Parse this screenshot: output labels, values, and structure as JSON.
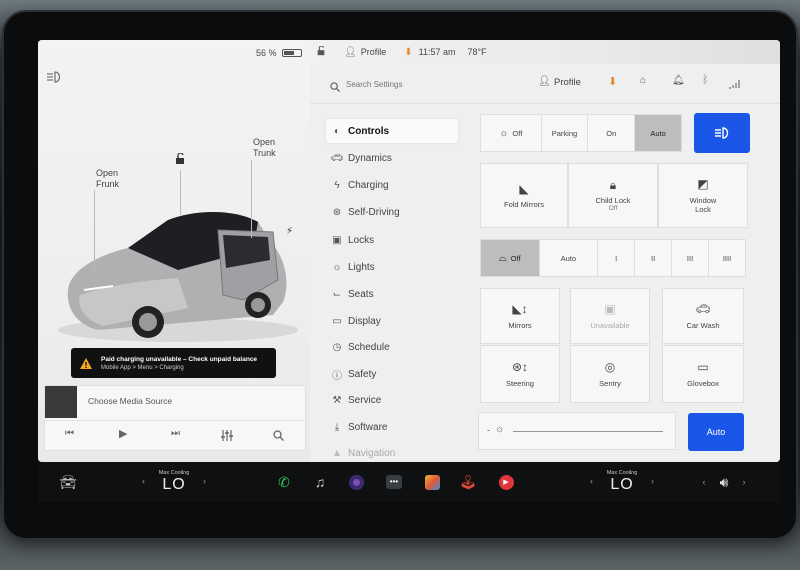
{
  "status": {
    "battery": "56 %",
    "profile": "Profile",
    "time": "11:57 am",
    "temperature": "78°F"
  },
  "left": {
    "open_frunk": "Open\nFrunk",
    "open_trunk": "Open\nTrunk",
    "alert_title": "Paid charging unavailable – Check unpaid balance",
    "alert_sub": "Mobile App > Menu > Charging",
    "media_source": "Choose Media Source"
  },
  "search": {
    "placeholder": "Search Settings"
  },
  "topbar": {
    "profile": "Profile"
  },
  "menu": [
    {
      "label": "Controls",
      "icon": "toggle-icon"
    },
    {
      "label": "Dynamics",
      "icon": "car-icon"
    },
    {
      "label": "Charging",
      "icon": "bolt-icon"
    },
    {
      "label": "Self-Driving",
      "icon": "steering-wheel-icon"
    },
    {
      "label": "Locks",
      "icon": "lock-icon"
    },
    {
      "label": "Lights",
      "icon": "sun-icon"
    },
    {
      "label": "Seats",
      "icon": "seat-icon"
    },
    {
      "label": "Display",
      "icon": "display-icon"
    },
    {
      "label": "Schedule",
      "icon": "clock-icon"
    },
    {
      "label": "Safety",
      "icon": "info-icon"
    },
    {
      "label": "Service",
      "icon": "wrench-icon"
    },
    {
      "label": "Software",
      "icon": "download-icon"
    },
    {
      "label": "Navigation",
      "icon": "navigation-icon"
    }
  ],
  "lights": {
    "off": "Off",
    "parking": "Parking",
    "on": "On",
    "auto": "Auto"
  },
  "row2": {
    "fold_mirrors": "Fold Mirrors",
    "child_lock": "Child Lock",
    "child_lock_state": "Off",
    "window_lock": "Window\nLock"
  },
  "wipers": {
    "off": "Off",
    "auto": "Auto",
    "s1": "I",
    "s2": "II",
    "s3": "III",
    "s4": "IIII"
  },
  "tiles": {
    "mirrors": "Mirrors",
    "unavailable": "Unavailable",
    "car_wash": "Car Wash",
    "steering": "Steering",
    "sentry": "Sentry",
    "glovebox": "Glovebox"
  },
  "brightness": {
    "auto": "Auto",
    "minus": "-"
  },
  "climate": {
    "left_label": "Max Cooling",
    "left_value": "LO",
    "right_label": "Max Cooling",
    "right_value": "LO"
  },
  "colors": {
    "accent_blue": "#1a57e8",
    "selected_gray": "#bdbdbd",
    "alert_bg": "#111111",
    "alert_icon": "#f5a623"
  }
}
